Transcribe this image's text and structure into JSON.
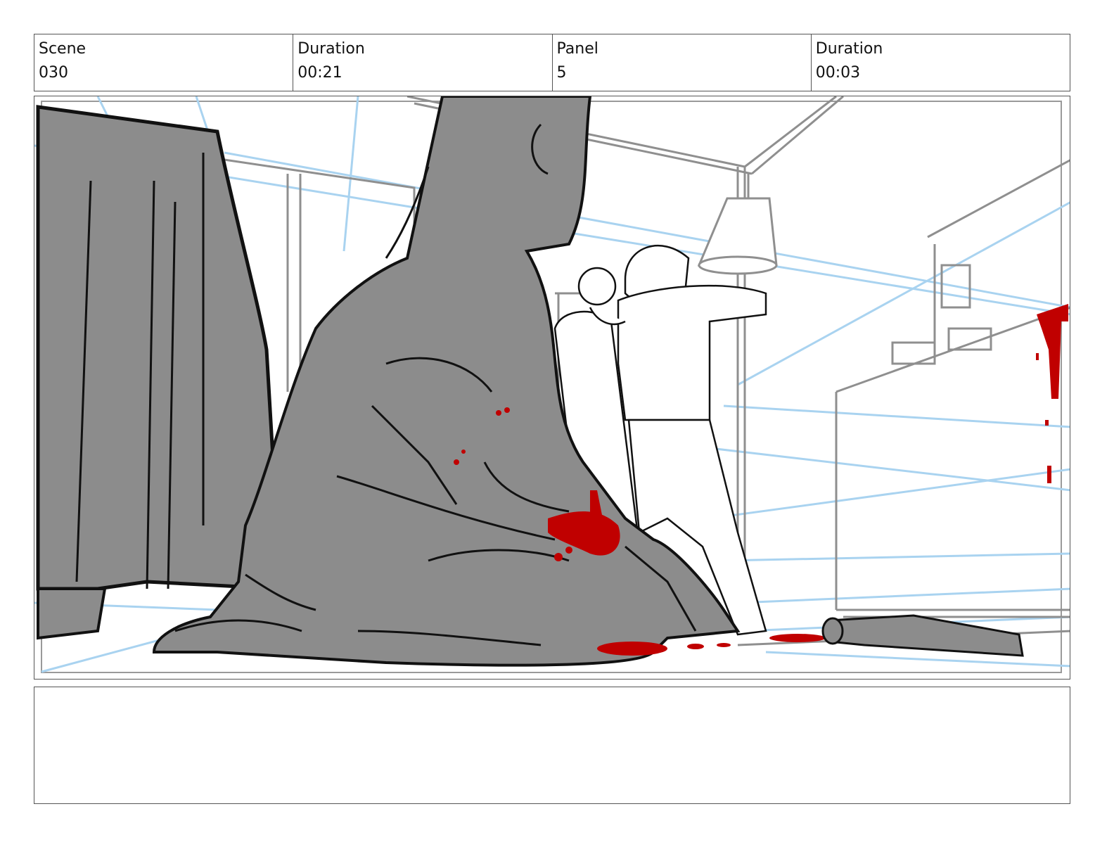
{
  "header": {
    "scene_label": "Scene",
    "scene_value": "030",
    "scene_duration_label": "Duration",
    "scene_duration_value": "00:21",
    "panel_label": "Panel",
    "panel_value": "5",
    "panel_duration_label": "Duration",
    "panel_duration_value": "00:03"
  },
  "notes": {
    "text": ""
  },
  "colors": {
    "guide_blue": "#a9d3f0",
    "figure_gray": "#8c8c8c",
    "blood_red": "#c00000",
    "ink": "#111111"
  }
}
